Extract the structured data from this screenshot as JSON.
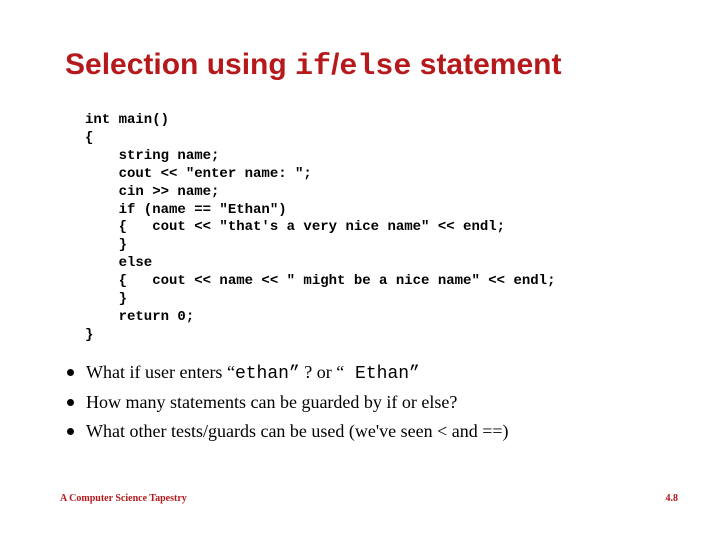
{
  "title": {
    "part1": "Selection using ",
    "mono1": "if",
    "slash": "/",
    "mono2": "else",
    "part2": " statement"
  },
  "code": "int main()\n{\n    string name;\n    cout << \"enter name: \";\n    cin >> name;\n    if (name == \"Ethan\")\n    {   cout << \"that's a very nice name\" << endl;\n    }\n    else\n    {   cout << name << \" might be a nice name\" << endl;\n    }\n    return 0;\n}",
  "bullets": {
    "b1": {
      "t1": "What if user enters “",
      "m1": "ethan”",
      "t2": " ? or “",
      "m2": " Ethan”"
    },
    "b2": "How many statements can be guarded by if or else?",
    "b3": "What other tests/guards can be used (we've seen < and ==)"
  },
  "footer": {
    "left": "A Computer Science Tapestry",
    "right": "4.8"
  }
}
